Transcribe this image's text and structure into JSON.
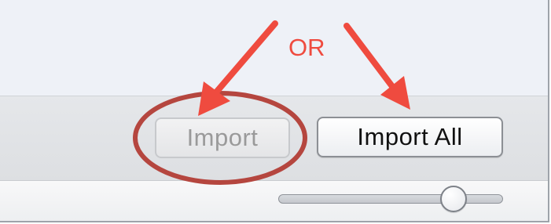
{
  "annotation": {
    "or_text": "OR",
    "color": "#ef4b3f",
    "circle_color": "#b5463f"
  },
  "buttons": {
    "import_label": "Import",
    "import_all_label": "Import All"
  },
  "slider": {
    "value_fraction": 0.73
  }
}
